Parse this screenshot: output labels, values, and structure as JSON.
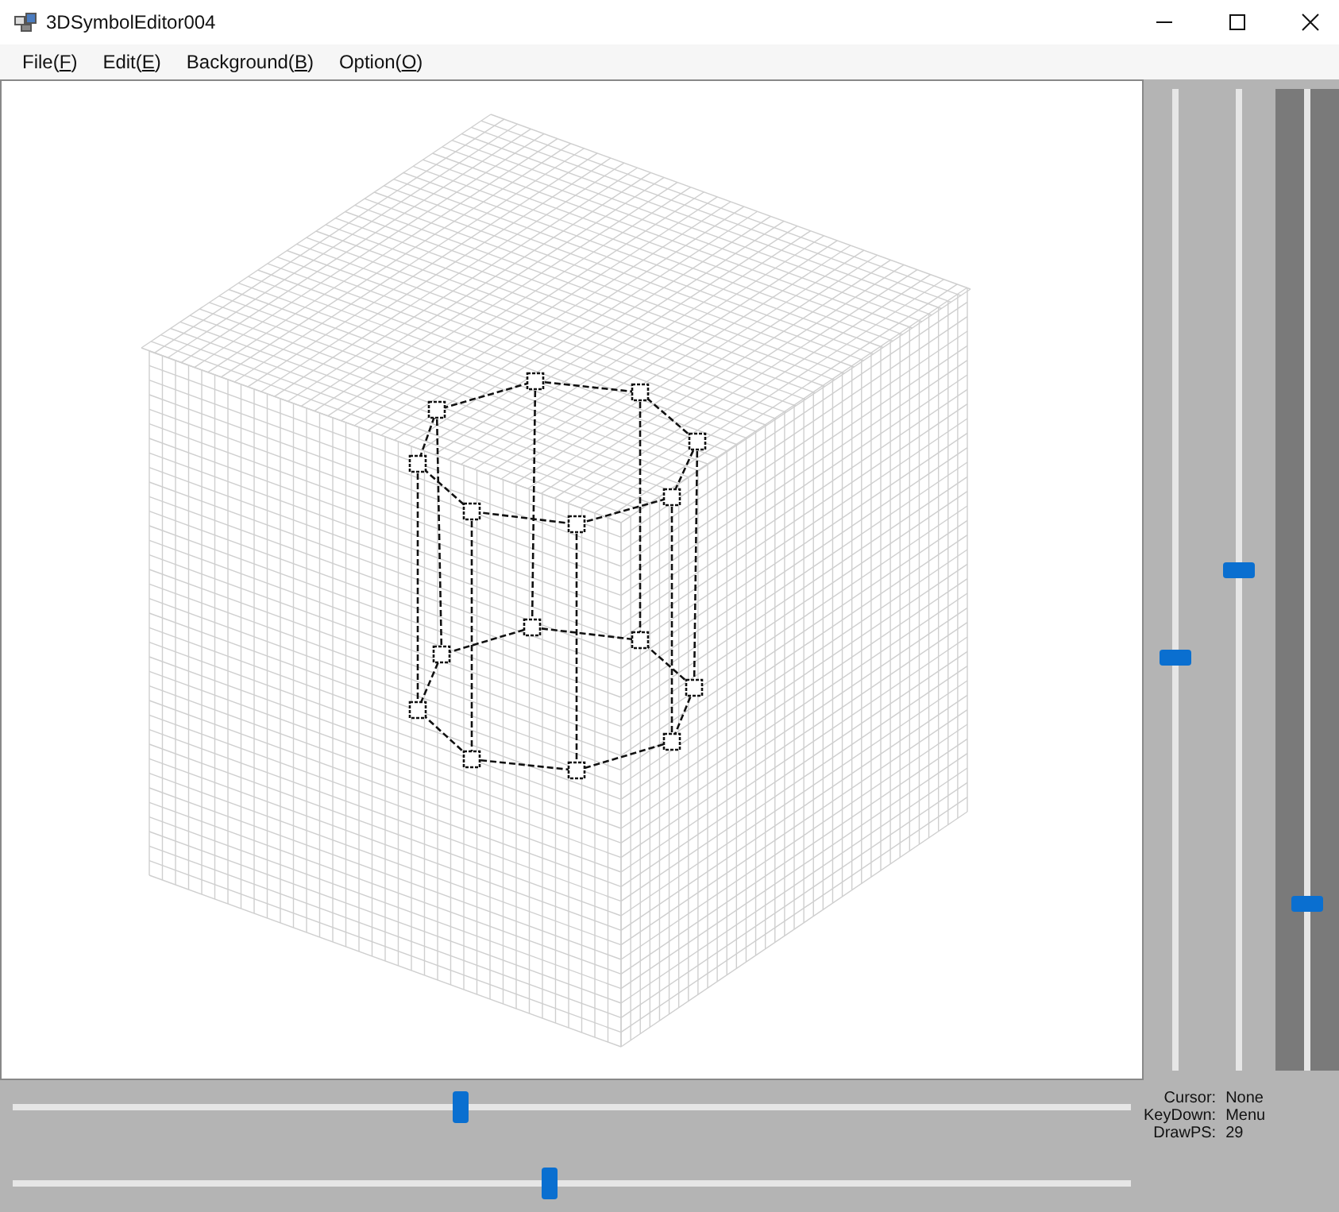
{
  "window": {
    "title": "3DSymbolEditor004"
  },
  "menu": [
    {
      "before": "File(",
      "key": "F",
      "after": ")"
    },
    {
      "before": "Edit(",
      "key": "E",
      "after": ")"
    },
    {
      "before": "Background(",
      "key": "B",
      "after": ")"
    },
    {
      "before": "Option(",
      "key": "O",
      "after": ")"
    }
  ],
  "right_sliders": [
    {
      "level": 0.42
    },
    {
      "level": 0.51
    },
    {
      "level": 0.17
    }
  ],
  "bottom_sliders": [
    {
      "level": 0.4
    },
    {
      "level": 0.48
    }
  ],
  "status": [
    {
      "label": "Cursor:",
      "value": "None"
    },
    {
      "label": "KeyDown:",
      "value": "Menu"
    },
    {
      "label": "DrawPS:",
      "value": "29"
    }
  ]
}
